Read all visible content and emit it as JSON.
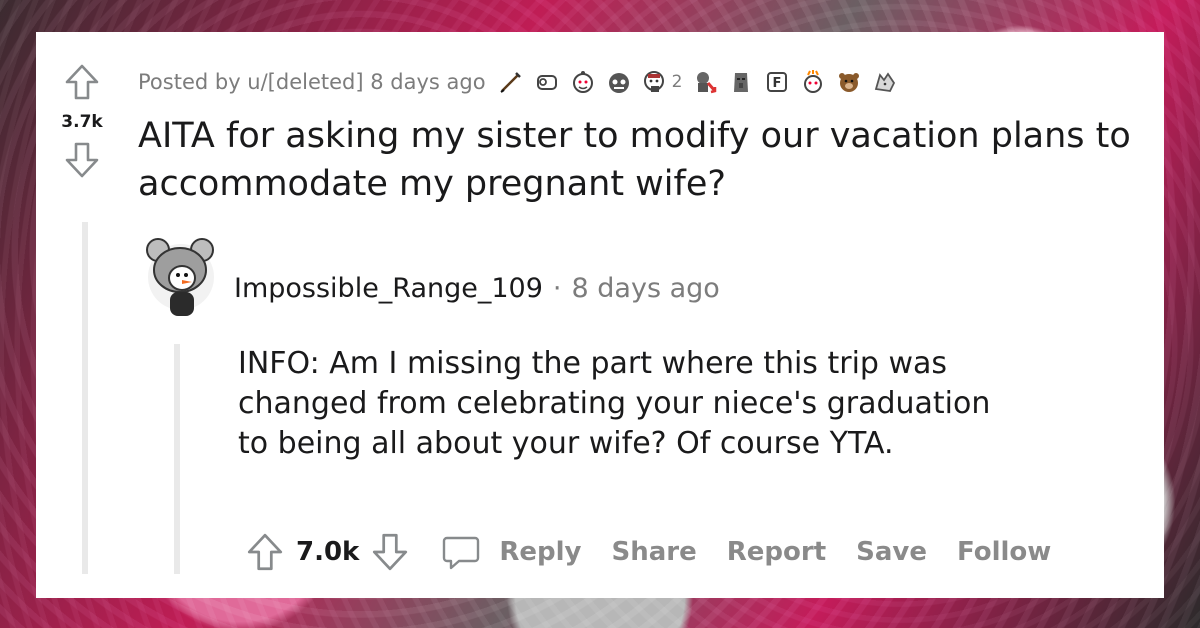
{
  "post": {
    "score": "3.7k",
    "meta_prefix": "Posted by u/[deleted] 8 days ago",
    "award_count": "2",
    "title": "AITA for asking my sister to modify our vacation plans to accommodate my pregnant wife?",
    "awards": [
      "pencil-award-icon",
      "box-award-icon",
      "wholesome-award-icon",
      "doom-award-icon",
      "cheers-award-icon",
      "stonks-down-award-icon",
      "moai-award-icon",
      "press-f-award-icon",
      "mind-blown-award-icon",
      "bear-award-icon",
      "wolf-award-icon"
    ]
  },
  "comment": {
    "username": "Impossible_Range_109",
    "dot": "·",
    "time": "8 days ago",
    "body": "INFO: Am I missing the part where this trip was changed from celebrating your niece's graduation to being all about your wife? Of course YTA.",
    "score": "7.0k",
    "actions": {
      "reply": "Reply",
      "share": "Share",
      "report": "Report",
      "save": "Save",
      "follow": "Follow"
    }
  },
  "colors": {
    "text_primary": "#1a1a1b",
    "text_meta": "#7c7c7c",
    "action_gray": "#8a8a8a",
    "card_bg": "#ffffff",
    "thread_line": "#e9e9e9",
    "bg_accent": "#c01d55"
  }
}
